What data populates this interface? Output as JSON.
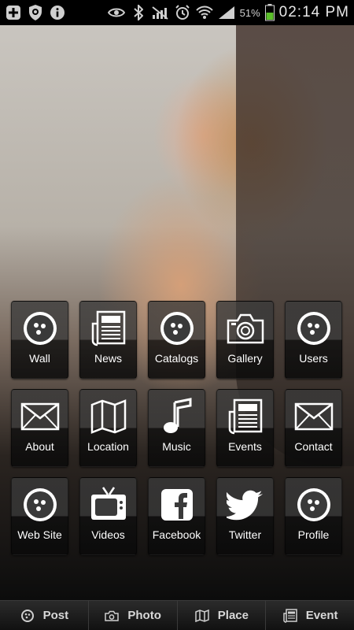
{
  "status_bar": {
    "battery": "51%",
    "time": "02:14 PM",
    "icons": [
      "add-icon",
      "shield-icon",
      "info-icon",
      "eye-icon",
      "bluetooth-icon",
      "no-signal-icon",
      "alarm-icon",
      "wifi-icon",
      "signal-icon",
      "battery-icon"
    ]
  },
  "tiles": [
    {
      "label": "Wall",
      "icon": "dots-icon"
    },
    {
      "label": "News",
      "icon": "news-icon"
    },
    {
      "label": "Catalogs",
      "icon": "dots-icon"
    },
    {
      "label": "Gallery",
      "icon": "camera-icon"
    },
    {
      "label": "Users",
      "icon": "dots-icon"
    },
    {
      "label": "About",
      "icon": "envelope-icon"
    },
    {
      "label": "Location",
      "icon": "map-icon"
    },
    {
      "label": "Music",
      "icon": "music-icon"
    },
    {
      "label": "Events",
      "icon": "news-icon"
    },
    {
      "label": "Contact",
      "icon": "envelope-icon"
    },
    {
      "label": "Web Site",
      "icon": "dots-icon"
    },
    {
      "label": "Videos",
      "icon": "tv-icon"
    },
    {
      "label": "Facebook",
      "icon": "facebook-icon"
    },
    {
      "label": "Twitter",
      "icon": "twitter-icon"
    },
    {
      "label": "Profile",
      "icon": "dots-icon"
    }
  ],
  "bottom_bar": {
    "post": "Post",
    "photo": "Photo",
    "place": "Place",
    "event": "Event"
  }
}
